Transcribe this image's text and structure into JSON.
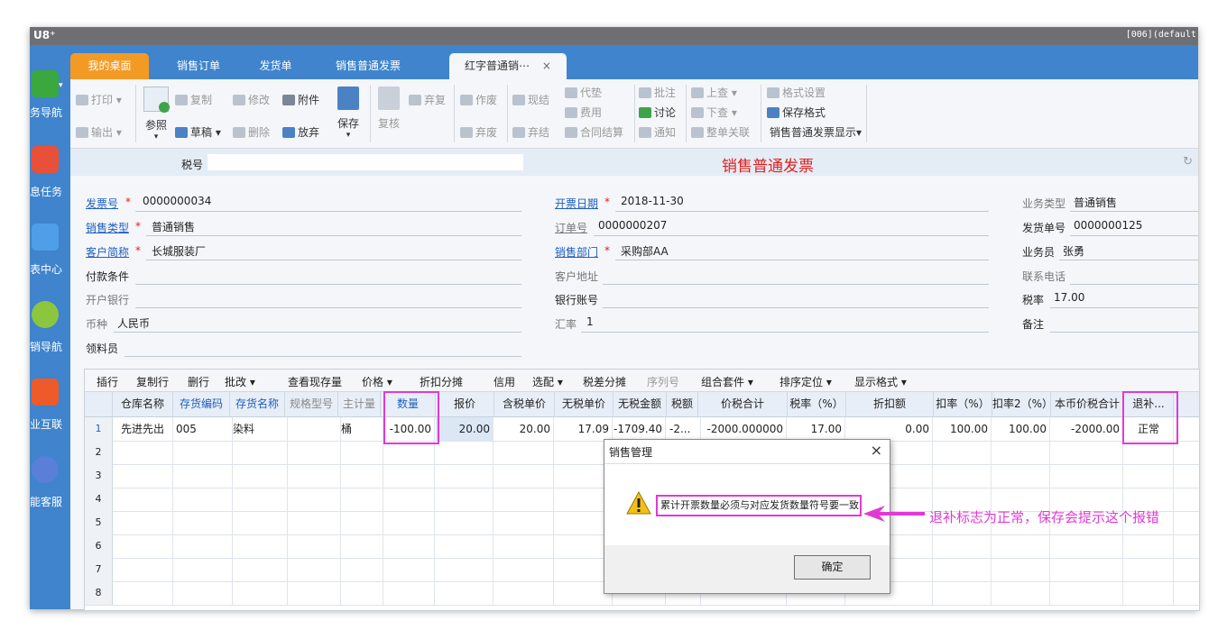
{
  "window": {
    "app_logo": "U8⁺",
    "title_right": "[006](default"
  },
  "sidebar": {
    "items": [
      {
        "label": "务导航",
        "icon": "business-nav-icon"
      },
      {
        "label": "息任务",
        "icon": "message-task-icon"
      },
      {
        "label": "表中心",
        "icon": "report-center-icon"
      },
      {
        "label": "销导航",
        "icon": "sales-nav-icon"
      },
      {
        "label": "业互联",
        "icon": "enterprise-connect-icon"
      },
      {
        "label": "能客服",
        "icon": "smart-service-icon"
      }
    ]
  },
  "tabs": [
    {
      "label": "我的桌面"
    },
    {
      "label": "销售订单"
    },
    {
      "label": "发货单"
    },
    {
      "label": "销售普通发票"
    },
    {
      "label": "红字普通销⋯",
      "close": "×"
    }
  ],
  "toolbar": {
    "print": "打印",
    "export": "输出",
    "reference": "参照",
    "copy": "复制",
    "draft": "草稿",
    "modify": "修改",
    "delete": "删除",
    "attach": "附件",
    "abandon": "放弃",
    "save": "保存",
    "review": "复核",
    "restore": "弃复",
    "void": "作废",
    "unvoid": "弃废",
    "cash": "现结",
    "unsettle": "弃结",
    "advance": "代垫",
    "expense": "费用",
    "contract_settle": "合同结算",
    "annotate": "批注",
    "discuss": "讨论",
    "notify": "通知",
    "prev": "上查",
    "next": "下查",
    "whole_link": "整单关联",
    "format_setting": "格式设置",
    "save_format": "保存格式",
    "display": "销售普通发票显示"
  },
  "form": {
    "tax_no_label": "税号",
    "tax_no_value": "",
    "title": "销售普通发票",
    "fields_left": [
      {
        "label": "发票号",
        "value": "0000000034"
      },
      {
        "label": "销售类型",
        "value": "普通销售"
      },
      {
        "label": "客户简称",
        "value": "长城服装厂"
      },
      {
        "label": "付款条件",
        "value": ""
      },
      {
        "label": "开户银行",
        "value": ""
      },
      {
        "label": "币种",
        "value": "人民币"
      },
      {
        "label": "领料员",
        "value": ""
      }
    ],
    "fields_mid": [
      {
        "label": "开票日期",
        "value": "2018-11-30"
      },
      {
        "label": "订单号",
        "value": "0000000207"
      },
      {
        "label": "销售部门",
        "value": "采购部AA"
      },
      {
        "label": "客户地址",
        "value": ""
      },
      {
        "label": "银行账号",
        "value": ""
      },
      {
        "label": "汇率",
        "value": "1"
      }
    ],
    "fields_right": [
      {
        "label": "业务类型",
        "value": "普通销售"
      },
      {
        "label": "发货单号",
        "value": "0000000125"
      },
      {
        "label": "业务员",
        "value": "张勇"
      },
      {
        "label": "联系电话",
        "value": ""
      },
      {
        "label": "税率",
        "value": "17.00"
      },
      {
        "label": "备注",
        "value": ""
      }
    ]
  },
  "grid_toolbar": {
    "insert_row": "插行",
    "copy_row": "复制行",
    "delete_row": "删行",
    "batch_modify": "批改",
    "stock": "查看现存量",
    "price": "价格",
    "discount_split": "折扣分摊",
    "credit": "信用",
    "pick": "选配",
    "tax_diff": "税差分摊",
    "serial": "序列号",
    "kit": "组合套件",
    "sort": "排序定位",
    "display": "显示格式"
  },
  "grid": {
    "columns": [
      "仓库名称",
      "存货编码",
      "存货名称",
      "规格型号",
      "主计量",
      "数量",
      "报价",
      "含税单价",
      "无税单价",
      "无税金额",
      "税额",
      "价税合计",
      "税率（%）",
      "折扣额",
      "扣率（%）",
      "扣率2（%）",
      "本币价税合计",
      "退补..."
    ],
    "rows": [
      {
        "n": "1",
        "cells": [
          "先进先出",
          "005",
          "染料",
          "",
          "桶",
          "-100.00",
          "20.00",
          "20.00",
          "17.09",
          "-1709.40",
          "-2...",
          "-2000.000000",
          "17.00",
          "0.00",
          "100.00",
          "100.00",
          "-2000.00",
          "正常"
        ]
      },
      {
        "n": "2",
        "cells": []
      },
      {
        "n": "3",
        "cells": []
      },
      {
        "n": "4",
        "cells": []
      },
      {
        "n": "5",
        "cells": []
      },
      {
        "n": "6",
        "cells": []
      },
      {
        "n": "7",
        "cells": []
      },
      {
        "n": "8",
        "cells": []
      }
    ]
  },
  "dialog": {
    "title": "销售管理",
    "close": "×",
    "message": "累计开票数量必须与对应发货数量符号要一致",
    "ok": "确定"
  },
  "annotation": "退补标志为正常，保存会提示这个报错",
  "colors": {
    "accent": "#3f84cc",
    "highlight": "#e03ad6",
    "title_red": "#e0201c",
    "home_tab": "#f39a25"
  }
}
